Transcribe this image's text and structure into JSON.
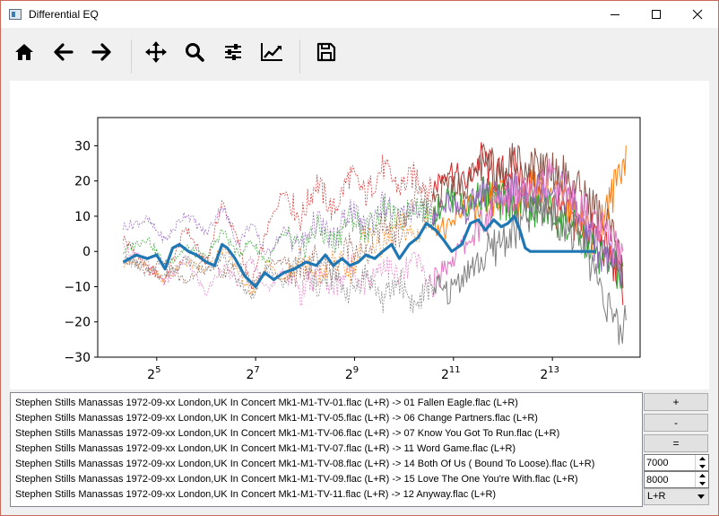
{
  "window": {
    "title": "Differential EQ"
  },
  "toolbar": [
    {
      "name": "home-button",
      "icon": "home-icon"
    },
    {
      "name": "back-button",
      "icon": "arrow-left-icon"
    },
    {
      "name": "forward-button",
      "icon": "arrow-right-icon"
    },
    {
      "name": "pan-button",
      "icon": "move-icon"
    },
    {
      "name": "zoom-button",
      "icon": "search-icon"
    },
    {
      "name": "configure-subplots-button",
      "icon": "sliders-icon"
    },
    {
      "name": "edit-axes-button",
      "icon": "chart-line-icon"
    },
    {
      "name": "save-button",
      "icon": "floppy-disk-icon"
    }
  ],
  "files": [
    "Stephen Stills Manassas 1972-09-xx London,UK In Concert Mk1-M1-TV-01.flac (L+R) -> 01 Fallen Eagle.flac (L+R)",
    "Stephen Stills Manassas 1972-09-xx London,UK In Concert Mk1-M1-TV-05.flac (L+R) -> 06 Change Partners.flac (L+R)",
    "Stephen Stills Manassas 1972-09-xx London,UK In Concert Mk1-M1-TV-06.flac (L+R) -> 07 Know You Got To Run.flac (L+R)",
    "Stephen Stills Manassas 1972-09-xx London,UK In Concert Mk1-M1-TV-07.flac (L+R) -> 11 Word Game.flac (L+R)",
    "Stephen Stills Manassas 1972-09-xx London,UK In Concert Mk1-M1-TV-08.flac (L+R) -> 14 Both Of Us ( Bound To Loose).flac (L+R)",
    "Stephen Stills Manassas 1972-09-xx London,UK In Concert Mk1-M1-TV-09.flac (L+R) -> 15 Love The One You're With.flac (L+R)",
    "Stephen Stills Manassas 1972-09-xx London,UK In Concert Mk1-M1-TV-11.flac (L+R) -> 12 Anyway.flac (L+R)"
  ],
  "controls": {
    "plus_label": "+",
    "minus_label": "-",
    "equal_label": "=",
    "freq_low": "7000",
    "freq_high": "8000",
    "channel": "L+R"
  },
  "chart_data": {
    "type": "line",
    "x_scale": "log2",
    "xlim": [
      14,
      28000
    ],
    "ylim": [
      -30,
      38
    ],
    "x_ticks": [
      {
        "base": "2",
        "exp": "5",
        "value": 32
      },
      {
        "base": "2",
        "exp": "7",
        "value": 128
      },
      {
        "base": "2",
        "exp": "9",
        "value": 512
      },
      {
        "base": "2",
        "exp": "11",
        "value": 2048
      },
      {
        "base": "2",
        "exp": "13",
        "value": 8192
      }
    ],
    "y_ticks": [
      {
        "label": "30",
        "value": 30
      },
      {
        "label": "20",
        "value": 20
      },
      {
        "label": "10",
        "value": 10
      },
      {
        "label": "0",
        "value": 0
      },
      {
        "label": "−10",
        "value": -10
      },
      {
        "label": "−20",
        "value": -20
      },
      {
        "label": "−30",
        "value": -30
      }
    ],
    "grid": false,
    "series": [
      {
        "color": "#d62728",
        "style": "dotted-then-solid",
        "values": [
          [
            20,
            4
          ],
          [
            28,
            -5
          ],
          [
            36,
            -8
          ],
          [
            48,
            7
          ],
          [
            64,
            -4
          ],
          [
            80,
            14
          ],
          [
            100,
            3
          ],
          [
            120,
            -10
          ],
          [
            150,
            6
          ],
          [
            190,
            18
          ],
          [
            240,
            9
          ],
          [
            300,
            20
          ],
          [
            380,
            11
          ],
          [
            480,
            22
          ],
          [
            600,
            16
          ],
          [
            760,
            24
          ],
          [
            960,
            18
          ],
          [
            1200,
            22
          ],
          [
            1500,
            17
          ],
          [
            1900,
            24
          ],
          [
            2400,
            19
          ],
          [
            3000,
            26
          ],
          [
            3800,
            21
          ],
          [
            4800,
            24
          ],
          [
            6000,
            18
          ],
          [
            7600,
            14
          ],
          [
            9600,
            10
          ],
          [
            12000,
            7
          ],
          [
            15000,
            5
          ],
          [
            19000,
            -3
          ],
          [
            22000,
            -10
          ]
        ]
      },
      {
        "color": "#ff7f0e",
        "style": "dotted-then-solid",
        "values": [
          [
            20,
            -3
          ],
          [
            28,
            -4
          ],
          [
            36,
            -8
          ],
          [
            48,
            -3
          ],
          [
            64,
            -6
          ],
          [
            80,
            1
          ],
          [
            100,
            -5
          ],
          [
            120,
            -13
          ],
          [
            150,
            -3
          ],
          [
            190,
            -8
          ],
          [
            240,
            -1
          ],
          [
            300,
            -9
          ],
          [
            380,
            -2
          ],
          [
            480,
            -6
          ],
          [
            600,
            5
          ],
          [
            760,
            1
          ],
          [
            960,
            8
          ],
          [
            1200,
            4
          ],
          [
            1500,
            10
          ],
          [
            1900,
            5
          ],
          [
            2400,
            14
          ],
          [
            3000,
            10
          ],
          [
            3800,
            16
          ],
          [
            4800,
            13
          ],
          [
            6000,
            19
          ],
          [
            7600,
            18
          ],
          [
            9600,
            14
          ],
          [
            12000,
            10
          ],
          [
            15000,
            4
          ],
          [
            19000,
            16
          ],
          [
            21000,
            24
          ],
          [
            23000,
            27
          ]
        ]
      },
      {
        "color": "#2ca02c",
        "style": "dotted-then-solid",
        "values": [
          [
            20,
            0
          ],
          [
            28,
            4
          ],
          [
            36,
            -4
          ],
          [
            48,
            1
          ],
          [
            64,
            -2
          ],
          [
            80,
            6
          ],
          [
            100,
            -1
          ],
          [
            120,
            3
          ],
          [
            150,
            -3
          ],
          [
            190,
            5
          ],
          [
            240,
            0
          ],
          [
            300,
            7
          ],
          [
            380,
            2
          ],
          [
            480,
            10
          ],
          [
            600,
            6
          ],
          [
            760,
            12
          ],
          [
            960,
            8
          ],
          [
            1200,
            14
          ],
          [
            1500,
            10
          ],
          [
            1900,
            16
          ],
          [
            2400,
            12
          ],
          [
            3000,
            17
          ],
          [
            3800,
            13
          ],
          [
            4800,
            15
          ],
          [
            6000,
            11
          ],
          [
            7600,
            12
          ],
          [
            9600,
            8
          ],
          [
            12000,
            5
          ],
          [
            15000,
            0
          ],
          [
            19000,
            -4
          ],
          [
            22000,
            -8
          ]
        ]
      },
      {
        "color": "#9467bd",
        "style": "dotted-then-solid",
        "values": [
          [
            20,
            7
          ],
          [
            28,
            9
          ],
          [
            36,
            3
          ],
          [
            48,
            11
          ],
          [
            64,
            5
          ],
          [
            80,
            13
          ],
          [
            100,
            2
          ],
          [
            120,
            8
          ],
          [
            150,
            -1
          ],
          [
            190,
            6
          ],
          [
            240,
            1
          ],
          [
            300,
            9
          ],
          [
            380,
            3
          ],
          [
            480,
            12
          ],
          [
            600,
            6
          ],
          [
            760,
            14
          ],
          [
            960,
            9
          ],
          [
            1200,
            13
          ],
          [
            1500,
            10
          ],
          [
            1900,
            15
          ],
          [
            2400,
            11
          ],
          [
            3000,
            17
          ],
          [
            3800,
            14
          ],
          [
            4800,
            18
          ],
          [
            6000,
            16
          ],
          [
            7600,
            19
          ],
          [
            9600,
            17
          ],
          [
            12000,
            10
          ],
          [
            15000,
            2
          ],
          [
            19000,
            -4
          ],
          [
            22000,
            -6
          ]
        ]
      },
      {
        "color": "#8c564b",
        "style": "dotted-then-solid",
        "values": [
          [
            20,
            -2
          ],
          [
            28,
            -6
          ],
          [
            36,
            -3
          ],
          [
            48,
            -9
          ],
          [
            64,
            -2
          ],
          [
            80,
            -7
          ],
          [
            100,
            -3
          ],
          [
            120,
            -10
          ],
          [
            150,
            -4
          ],
          [
            190,
            -2
          ],
          [
            240,
            -8
          ],
          [
            300,
            -1
          ],
          [
            380,
            -6
          ],
          [
            480,
            3
          ],
          [
            600,
            -2
          ],
          [
            760,
            8
          ],
          [
            960,
            4
          ],
          [
            1200,
            16
          ],
          [
            1500,
            12
          ],
          [
            1900,
            20
          ],
          [
            2400,
            18
          ],
          [
            3000,
            25
          ],
          [
            3800,
            23
          ],
          [
            4800,
            26
          ],
          [
            6000,
            24
          ],
          [
            7600,
            25
          ],
          [
            9600,
            22
          ],
          [
            12000,
            17
          ],
          [
            15000,
            12
          ],
          [
            19000,
            4
          ],
          [
            22000,
            -6
          ]
        ]
      },
      {
        "color": "#e377c2",
        "style": "dotted-then-solid",
        "values": [
          [
            20,
            1
          ],
          [
            28,
            -3
          ],
          [
            36,
            -9
          ],
          [
            48,
            -2
          ],
          [
            64,
            -12
          ],
          [
            80,
            -4
          ],
          [
            100,
            -9
          ],
          [
            120,
            -2
          ],
          [
            150,
            -11
          ],
          [
            190,
            -5
          ],
          [
            240,
            -12
          ],
          [
            300,
            -6
          ],
          [
            380,
            -11
          ],
          [
            480,
            -4
          ],
          [
            600,
            -9
          ],
          [
            760,
            -3
          ],
          [
            960,
            -8
          ],
          [
            1200,
            -2
          ],
          [
            1500,
            -10
          ],
          [
            1900,
            -3
          ],
          [
            2400,
            2
          ],
          [
            3000,
            7
          ],
          [
            3800,
            13
          ],
          [
            4800,
            17
          ],
          [
            6000,
            20
          ],
          [
            7600,
            21
          ],
          [
            9600,
            18
          ],
          [
            12000,
            12
          ],
          [
            15000,
            8
          ],
          [
            19000,
            2
          ],
          [
            22000,
            -3
          ]
        ]
      },
      {
        "color": "#7f7f7f",
        "style": "dotted-then-solid",
        "values": [
          [
            20,
            -2
          ],
          [
            28,
            -5
          ],
          [
            36,
            -7
          ],
          [
            48,
            -2
          ],
          [
            64,
            -6
          ],
          [
            80,
            -1
          ],
          [
            100,
            -8
          ],
          [
            120,
            -13
          ],
          [
            150,
            -5
          ],
          [
            190,
            -9
          ],
          [
            240,
            -3
          ],
          [
            300,
            -10
          ],
          [
            380,
            -7
          ],
          [
            480,
            -12
          ],
          [
            600,
            -6
          ],
          [
            760,
            -14
          ],
          [
            960,
            -8
          ],
          [
            1200,
            -16
          ],
          [
            1500,
            -9
          ],
          [
            1900,
            -12
          ],
          [
            2400,
            -6
          ],
          [
            3000,
            -3
          ],
          [
            3800,
            2
          ],
          [
            4800,
            6
          ],
          [
            6000,
            10
          ],
          [
            7600,
            12
          ],
          [
            9600,
            8
          ],
          [
            12000,
            4
          ],
          [
            15000,
            -6
          ],
          [
            19000,
            -18
          ],
          [
            21000,
            -25
          ],
          [
            23000,
            -17
          ]
        ]
      },
      {
        "color": "#1f77b4",
        "style": "thick",
        "values": [
          [
            20,
            -3
          ],
          [
            24,
            -1
          ],
          [
            28,
            -2
          ],
          [
            32,
            -1
          ],
          [
            36,
            -5
          ],
          [
            40,
            1
          ],
          [
            44,
            2
          ],
          [
            50,
            0
          ],
          [
            56,
            -1
          ],
          [
            64,
            -3
          ],
          [
            72,
            -4
          ],
          [
            80,
            2
          ],
          [
            86,
            1
          ],
          [
            96,
            -2
          ],
          [
            110,
            -7
          ],
          [
            128,
            -10
          ],
          [
            145,
            -6
          ],
          [
            165,
            -8
          ],
          [
            190,
            -6
          ],
          [
            220,
            -5
          ],
          [
            260,
            -3
          ],
          [
            300,
            -4
          ],
          [
            340,
            -1
          ],
          [
            380,
            -4
          ],
          [
            430,
            -2
          ],
          [
            480,
            -4
          ],
          [
            540,
            -3
          ],
          [
            600,
            -1
          ],
          [
            680,
            -2
          ],
          [
            760,
            0
          ],
          [
            860,
            2
          ],
          [
            960,
            -2
          ],
          [
            1100,
            2
          ],
          [
            1250,
            4
          ],
          [
            1400,
            8
          ],
          [
            1600,
            6
          ],
          [
            1800,
            3
          ],
          [
            2000,
            0
          ],
          [
            2300,
            2
          ],
          [
            2600,
            8
          ],
          [
            2900,
            9
          ],
          [
            3200,
            6
          ],
          [
            3600,
            9
          ],
          [
            4000,
            7
          ],
          [
            4400,
            8
          ],
          [
            4800,
            10
          ],
          [
            5200,
            6
          ],
          [
            5600,
            1
          ],
          [
            6000,
            0
          ],
          [
            7000,
            0
          ],
          [
            8000,
            0
          ],
          [
            12000,
            0
          ],
          [
            15000,
            0
          ]
        ]
      }
    ]
  }
}
